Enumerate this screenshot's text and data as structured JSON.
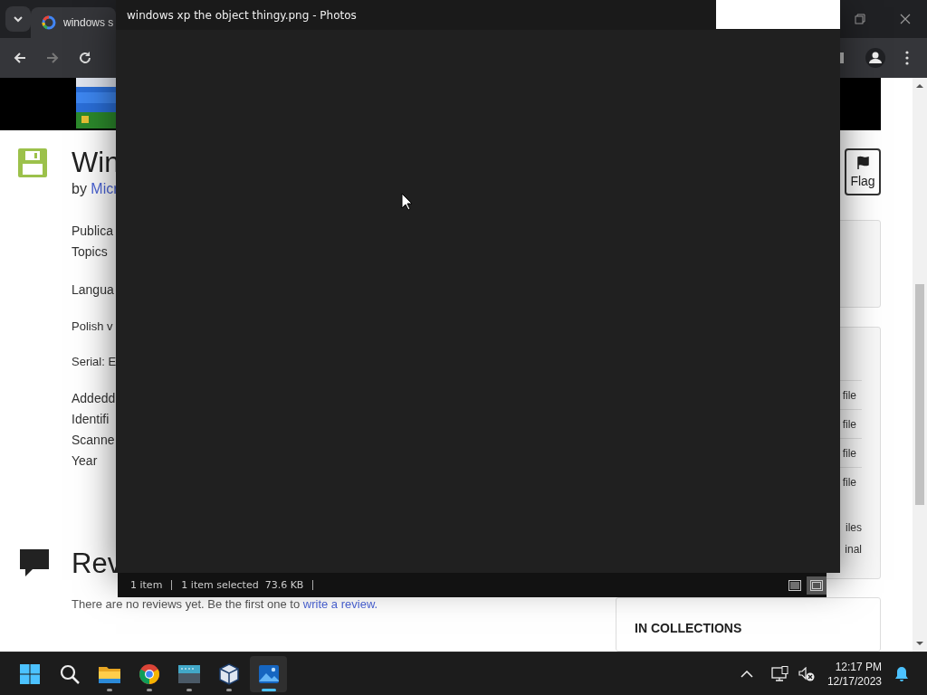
{
  "browser": {
    "tab": {
      "title": "windows s",
      "selected": true
    },
    "nav": [
      {
        "kind": "back",
        "disabled": false
      },
      {
        "kind": "forward",
        "disabled": true
      },
      {
        "kind": "reload",
        "disabled": false
      }
    ],
    "page": {
      "title": "Win",
      "byline": "by",
      "author": "Micr",
      "meta": [
        {
          "kind": "field",
          "lines": [
            "Publica",
            "Topics"
          ]
        },
        {
          "kind": "field",
          "lines": [
            "Langua"
          ]
        },
        {
          "kind": "note",
          "lines": [
            "Polish v"
          ]
        },
        {
          "kind": "note",
          "lines": [
            "Serial: E"
          ]
        },
        {
          "kind": "field",
          "lines": [
            "Addedd",
            "Identifi",
            "Scanne",
            "Year"
          ]
        }
      ],
      "reviews": {
        "title": "Rev",
        "text": "There are no reviews yet. Be the first one to",
        "link": "write a review."
      },
      "flag_button": "Flag",
      "file_rows": [
        "file",
        "file",
        "file",
        "file"
      ],
      "extra_rows": [
        "iles",
        "inal"
      ],
      "collections_title": "IN COLLECTIONS"
    }
  },
  "photos": {
    "title": "windows xp the object thingy.png - Photos",
    "status": {
      "count": "1 item",
      "selected": "1 item selected",
      "size": "73.6 KB"
    },
    "views": [
      {
        "kind": "details",
        "selected": false
      },
      {
        "kind": "large",
        "selected": true
      }
    ]
  },
  "taskbar": {
    "apps": [
      {
        "kind": "start",
        "running": false,
        "selected": false
      },
      {
        "kind": "search",
        "running": false,
        "selected": false
      },
      {
        "kind": "files",
        "running": true,
        "selected": false
      },
      {
        "kind": "chrome",
        "running": true,
        "selected": false
      },
      {
        "kind": "terminal",
        "running": true,
        "selected": false
      },
      {
        "kind": "box",
        "running": true,
        "selected": false
      },
      {
        "kind": "photos",
        "running": true,
        "selected": true
      }
    ],
    "time": "12:17 PM",
    "date": "12/17/2023"
  }
}
